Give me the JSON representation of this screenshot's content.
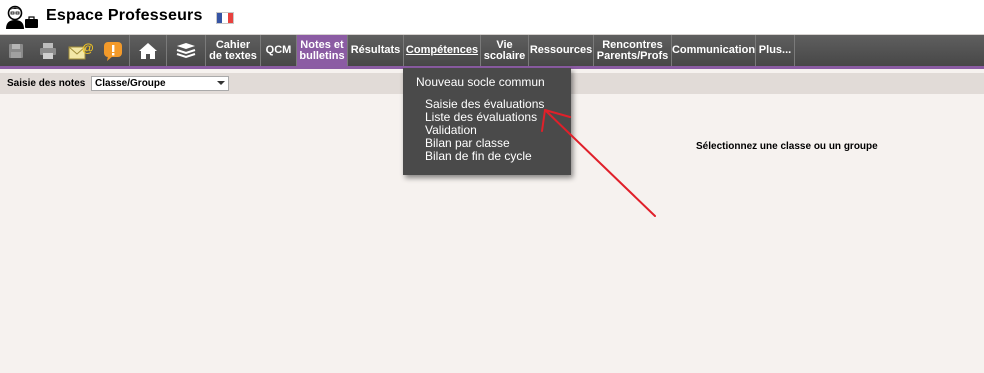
{
  "header": {
    "title": "Espace Professeurs",
    "flag_colors": [
      "#3554a4",
      "#ffffff",
      "#e8413e"
    ]
  },
  "toolbar": {
    "icons": [
      "save-icon",
      "print-icon",
      "mail-icon",
      "alert-icon",
      "home-icon",
      "stack-icon"
    ],
    "items": [
      {
        "label_1": "Cahier",
        "label_2": "de textes"
      },
      {
        "label_1": "QCM",
        "label_2": ""
      },
      {
        "label_1": "Notes et",
        "label_2": "bulletins"
      },
      {
        "label_1": "Résultats",
        "label_2": ""
      },
      {
        "label_1": "Compétences",
        "label_2": ""
      },
      {
        "label_1": "Vie",
        "label_2": "scolaire"
      },
      {
        "label_1": "Ressources",
        "label_2": ""
      },
      {
        "label_1": "Rencontres",
        "label_2": "Parents/Profs"
      },
      {
        "label_1": "Communication",
        "label_2": ""
      },
      {
        "label_1": "Plus...",
        "label_2": ""
      }
    ],
    "active_color": "#8b5ca3"
  },
  "subbar": {
    "label": "Saisie des notes",
    "select_value": "Classe/Groupe"
  },
  "dropdown": {
    "header": "Nouveau socle commun",
    "items": [
      "Saisie des évaluations",
      "Liste des évaluations",
      "Validation",
      "Bilan par classe",
      "Bilan de fin de cycle"
    ]
  },
  "main": {
    "message": "Sélectionnez une classe ou un groupe"
  },
  "annotation": {
    "arrow_color": "#e0202a"
  }
}
